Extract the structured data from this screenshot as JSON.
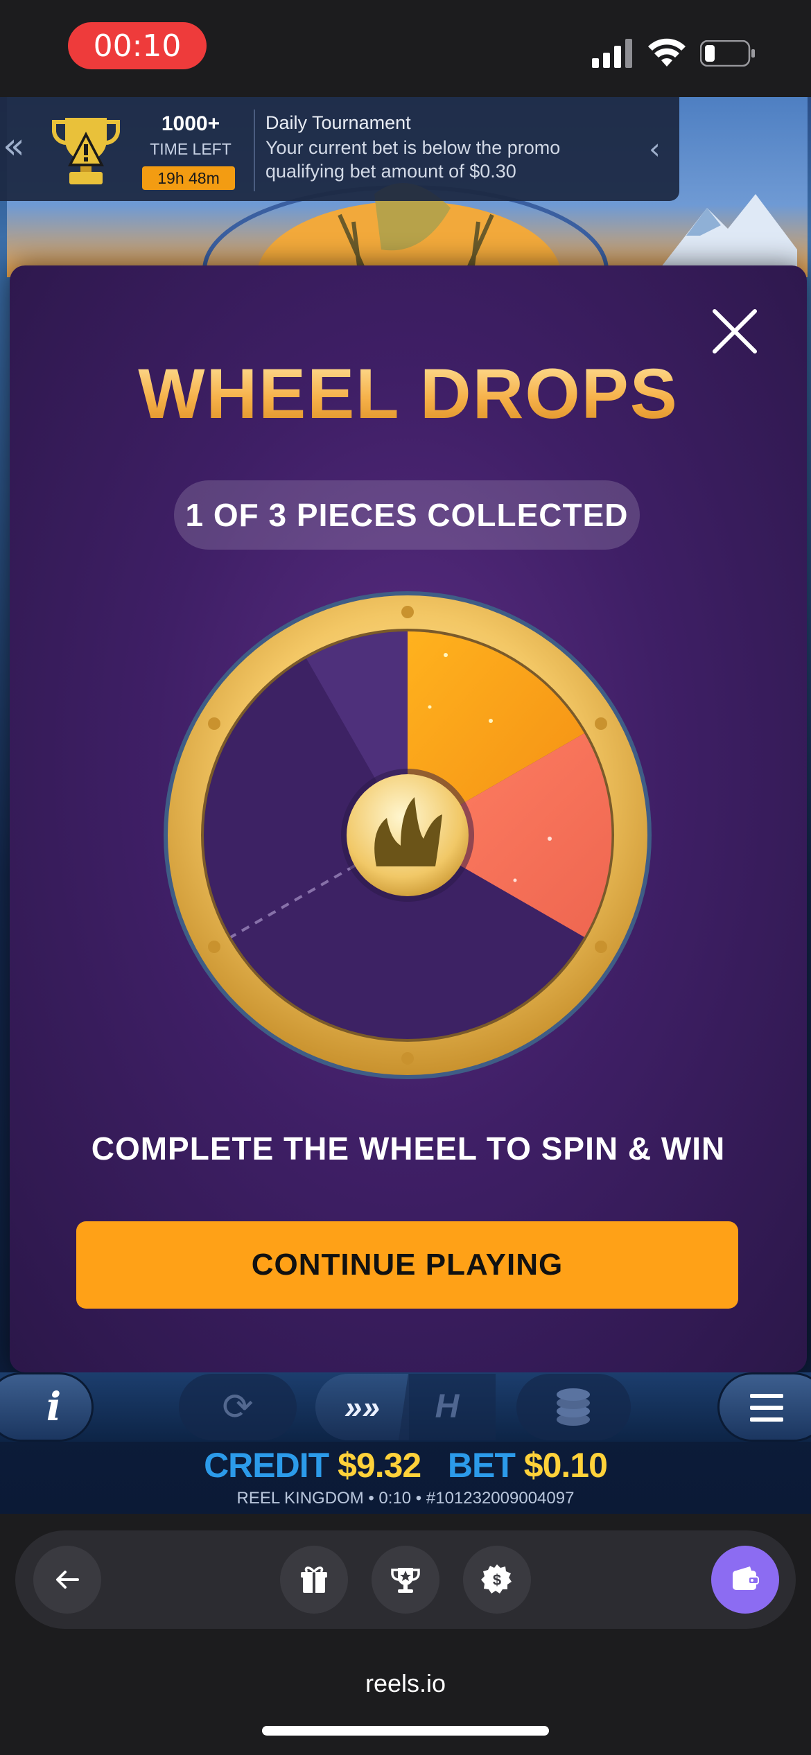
{
  "status_bar": {
    "recording_time": "00:10"
  },
  "tournament": {
    "count": "1000+",
    "time_left_label": "TIME LEFT",
    "time_left": "19h 48m",
    "title": "Daily Tournament",
    "message": "Your current bet is below the promo qualifying bet amount of $0.30",
    "collapse_icon": "double-chevron-left-icon",
    "expand_icon": "chevron-left-icon"
  },
  "modal": {
    "title": "WHEEL DROPS",
    "progress_text": "1 OF 3 PIECES COLLECTED",
    "pieces_collected": 1,
    "pieces_total": 3,
    "caption": "COMPLETE THE WHEEL TO SPIN & WIN",
    "continue_label": "CONTINUE PLAYING",
    "close_icon": "close-icon",
    "colors": {
      "title_gold": "#f6b14a",
      "segment_orange": "#f8a21f",
      "segment_coral": "#f2735a",
      "button": "#ffa117"
    }
  },
  "game_toolbar": {
    "info_label": "i",
    "turbo_label": "»»",
    "hyper_label": "H"
  },
  "game_info": {
    "credit_label": "CREDIT",
    "credit_value": "$9.32",
    "bet_label": "BET",
    "bet_value": "$0.10",
    "meta": "REEL KINGDOM • 0:10 • #101232009004097"
  },
  "bottom_nav": {
    "items": [
      "back-arrow-icon",
      "gift-icon",
      "trophy-icon",
      "dollar-gear-icon",
      "wallet-icon"
    ],
    "accent": "#8c6cf2"
  },
  "browser": {
    "url": "reels.io"
  }
}
